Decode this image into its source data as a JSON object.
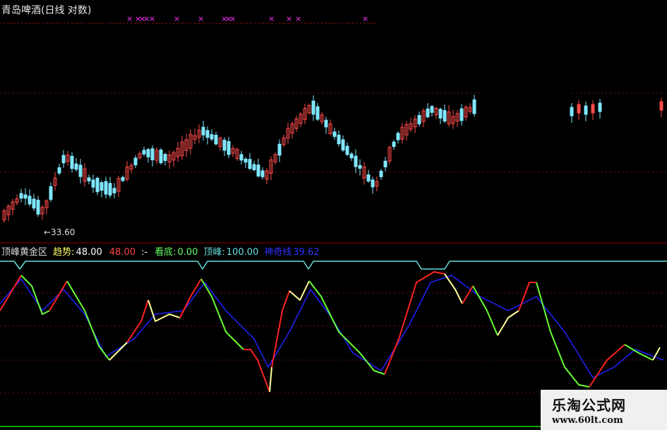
{
  "window": {
    "title": "青岛啤酒(日线 对数)"
  },
  "price_panel": {
    "low_label": "←33.60",
    "marker_glyph": "×",
    "colors": {
      "up": "#ff4a4a",
      "down": "#7fe7ff",
      "marker": "#ff33ff",
      "grid": "#7a1010"
    }
  },
  "indicator_panel": {
    "name": "顶峰黄金区",
    "items": [
      {
        "label": "趋势:",
        "value": "48.00",
        "label_color": "#ffff66",
        "value_color": "#ffffff"
      },
      {
        "label": "",
        "value": "48.00",
        "label_color": "#ff4444",
        "value_color": "#ff4444"
      },
      {
        "label": ":-",
        "value": "",
        "label_color": "#ffffff",
        "value_color": "#ffffff"
      },
      {
        "label": "看底:",
        "value": "0.00",
        "label_color": "#66ff66",
        "value_color": "#66ff66"
      },
      {
        "label": "顶峰:",
        "value": "100.00",
        "label_color": "#66dddd",
        "value_color": "#66dddd"
      },
      {
        "label": "神奇线",
        "value": "39.62",
        "label_color": "#3333ff",
        "value_color": "#3333ff"
      }
    ],
    "colors": {
      "up_line": "#ff2222",
      "down_line": "#66ff33",
      "turn_line": "#ffff99",
      "slow_line": "#2222ff",
      "cap_line": "#66dddd",
      "bottom_line": "#00aa00"
    }
  },
  "watermark": {
    "name": "乐淘公式网",
    "url": "www.60lt.com"
  }
}
